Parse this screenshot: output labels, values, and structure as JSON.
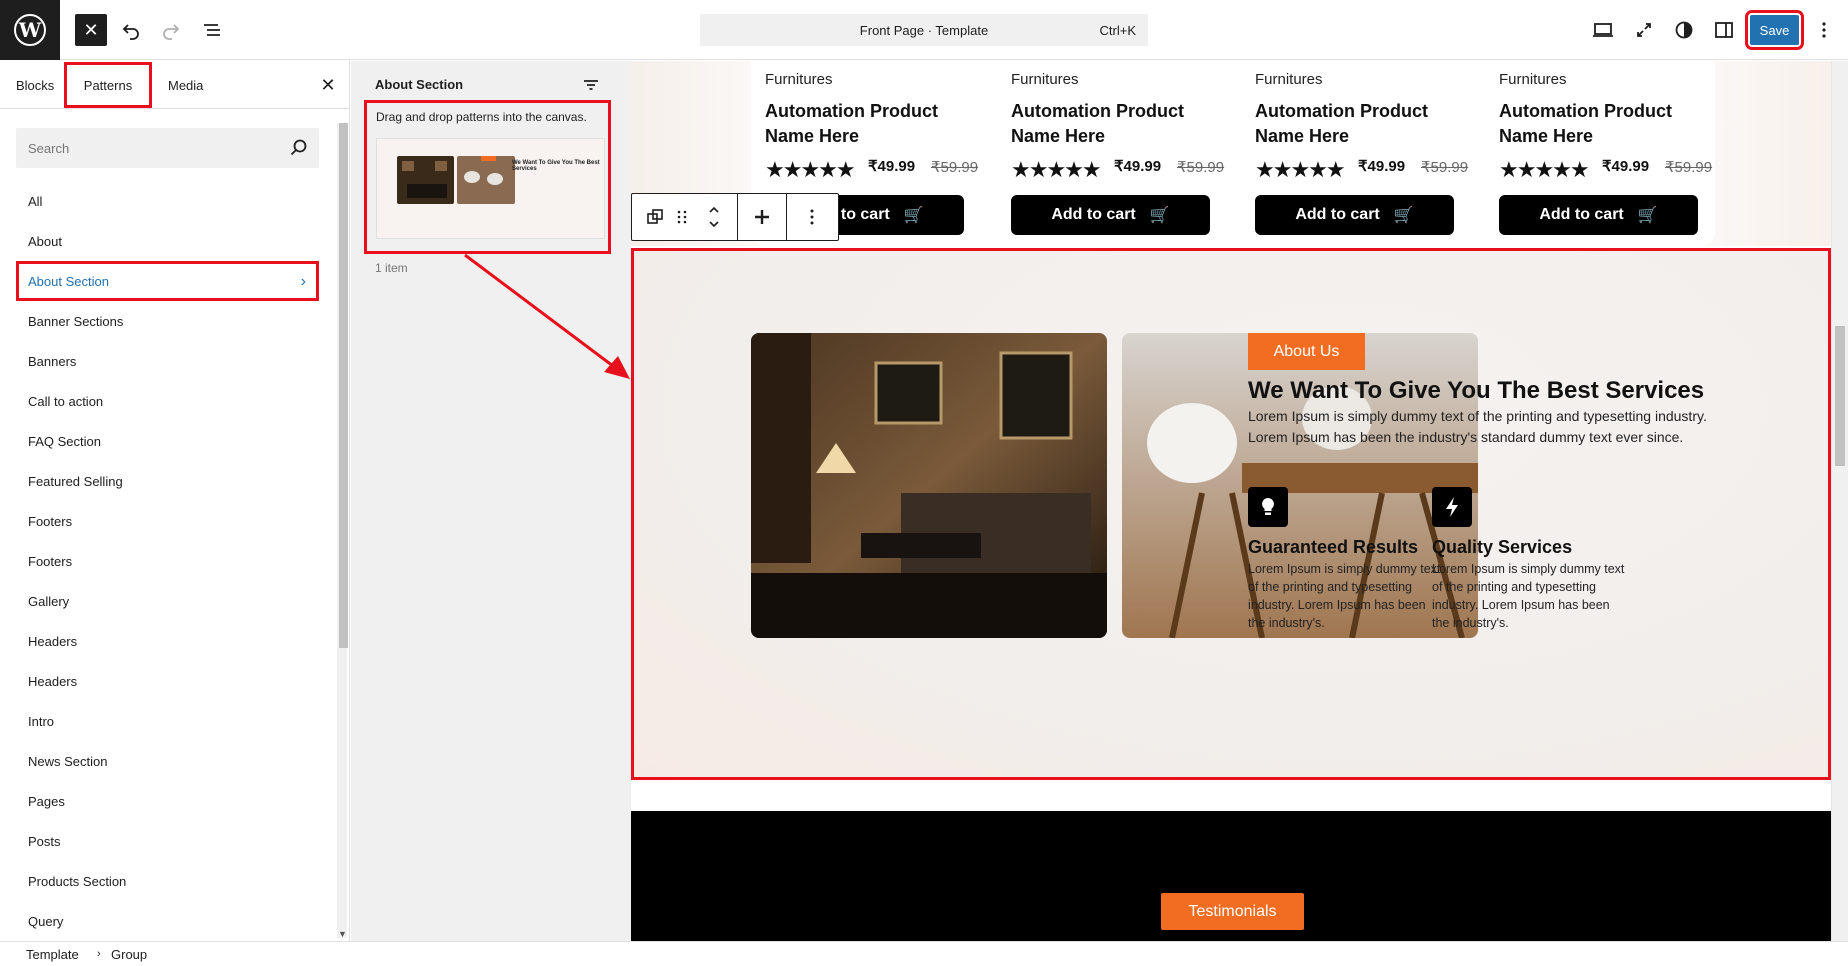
{
  "header": {
    "command_title": "Front Page · Template",
    "command_shortcut": "Ctrl+K",
    "save_label": "Save"
  },
  "sidebar": {
    "tabs": [
      "Blocks",
      "Patterns",
      "Media"
    ],
    "search_placeholder": "Search",
    "categories": [
      "All",
      "About",
      "About Section",
      "Banner Sections",
      "Banners",
      "Call to action",
      "FAQ Section",
      "Featured Selling",
      "Footers",
      "Footers",
      "Gallery",
      "Headers",
      "Headers",
      "Intro",
      "News Section",
      "Pages",
      "Posts",
      "Products Section",
      "Query"
    ],
    "selected_category": "About Section"
  },
  "pattern_panel": {
    "title": "About Section",
    "hint": "Drag and drop patterns into the canvas.",
    "count": "1 item",
    "thumb_heading": "We Want To Give You The Best Services"
  },
  "products": [
    {
      "category": "Furnitures",
      "name": "Automation Product Name Here",
      "stars": "★★★★★",
      "price": "₹49.99",
      "old_price": "₹59.99",
      "cart_label": "Add to cart"
    },
    {
      "category": "Furnitures",
      "name": "Automation Product Name Here",
      "stars": "★★★★★",
      "price": "₹49.99",
      "old_price": "₹59.99",
      "cart_label": "Add to cart"
    },
    {
      "category": "Furnitures",
      "name": "Automation Product Name Here",
      "stars": "★★★★★",
      "price": "₹49.99",
      "old_price": "₹59.99",
      "cart_label": "Add to cart"
    },
    {
      "category": "Furnitures",
      "name": "Automation Product Name Here",
      "stars": "★★★★★",
      "price": "₹49.99",
      "old_price": "₹59.99",
      "cart_label": "Add to cart"
    }
  ],
  "about": {
    "badge": "About Us",
    "heading": "We Want To Give You The Best Services",
    "paragraph": "Lorem Ipsum is simply dummy text of the printing and typesetting industry. Lorem Ipsum has been the industry's standard dummy text ever since.",
    "features": [
      {
        "title": "Guaranteed Results",
        "text": "Lorem Ipsum is simply dummy text of the printing and typesetting industry. Lorem Ipsum has been the industry's.",
        "icon": "lightbulb-icon"
      },
      {
        "title": "Quality Services",
        "text": "Lorem Ipsum is simply dummy text of the printing and typesetting industry. Lorem Ipsum has been the industry's.",
        "icon": "bolt-icon"
      }
    ]
  },
  "testimonials": {
    "badge": "Testimonials"
  },
  "breadcrumbs": [
    "Template",
    "Group"
  ],
  "colors": {
    "annotation": "#e8101c",
    "accent": "#2271b1",
    "brand_orange": "#f26d21"
  }
}
